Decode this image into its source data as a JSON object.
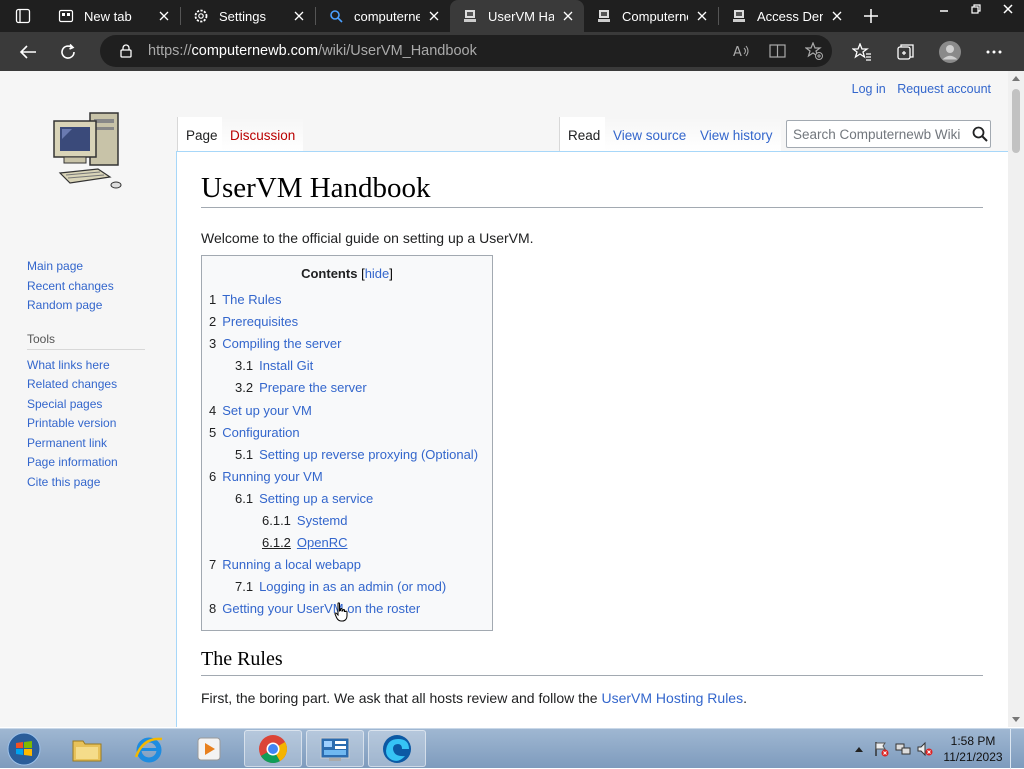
{
  "browser": {
    "tabs": [
      {
        "title": "New tab",
        "icon": "new-tab-icon"
      },
      {
        "title": "Settings",
        "icon": "gear-icon"
      },
      {
        "title": "computernew",
        "icon": "search-icon"
      },
      {
        "title": "UserVM Hand",
        "icon": "wiki-icon",
        "active": true
      },
      {
        "title": "Computernew",
        "icon": "wiki-icon"
      },
      {
        "title": "Access Denie",
        "icon": "wiki-icon"
      }
    ],
    "url_scheme": "https://",
    "url_host": "computernewb.com",
    "url_path": "/wiki/UserVM_Handbook"
  },
  "wiki": {
    "personal": {
      "login": "Log in",
      "request": "Request account"
    },
    "tabs": {
      "page": "Page",
      "discussion": "Discussion",
      "read": "Read",
      "view_source": "View source",
      "view_history": "View history"
    },
    "search_placeholder": "Search Computernewb Wiki",
    "sidebar": {
      "nav": [
        "Main page",
        "Recent changes",
        "Random page"
      ],
      "tools_heading": "Tools",
      "tools": [
        "What links here",
        "Related changes",
        "Special pages",
        "Printable version",
        "Permanent link",
        "Page information",
        "Cite this page"
      ]
    },
    "title": "UserVM Handbook",
    "intro": "Welcome to the official guide on setting up a UserVM.",
    "toc": {
      "title": "Contents",
      "hide_open": "[",
      "hide": "hide",
      "hide_close": "]",
      "items": [
        {
          "num": "1",
          "text": "The Rules",
          "level": 1
        },
        {
          "num": "2",
          "text": "Prerequisites",
          "level": 1
        },
        {
          "num": "3",
          "text": "Compiling the server",
          "level": 1
        },
        {
          "num": "3.1",
          "text": "Install Git",
          "level": 2
        },
        {
          "num": "3.2",
          "text": "Prepare the server",
          "level": 2
        },
        {
          "num": "4",
          "text": "Set up your VM",
          "level": 1
        },
        {
          "num": "5",
          "text": "Configuration",
          "level": 1
        },
        {
          "num": "5.1",
          "text": "Setting up reverse proxying (Optional)",
          "level": 2
        },
        {
          "num": "6",
          "text": "Running your VM",
          "level": 1
        },
        {
          "num": "6.1",
          "text": "Setting up a service",
          "level": 2
        },
        {
          "num": "6.1.1",
          "text": "Systemd",
          "level": 3
        },
        {
          "num": "6.1.2",
          "text": "OpenRC",
          "level": 3,
          "hover": true
        },
        {
          "num": "7",
          "text": "Running a local webapp",
          "level": 1
        },
        {
          "num": "7.1",
          "text": "Logging in as an admin (or mod)",
          "level": 2
        },
        {
          "num": "8",
          "text": "Getting your UserVM on the roster",
          "level": 1
        }
      ]
    },
    "section_rules": {
      "heading": "The Rules",
      "text": "First, the boring part. We ask that all hosts review and follow the ",
      "link": "UserVM Hosting Rules",
      "after": "."
    }
  },
  "taskbar": {
    "apps": [
      "explorer-icon",
      "ie-icon",
      "media-player-icon",
      "chrome-icon",
      "control-panel-icon",
      "edge-icon"
    ],
    "time": "1:58 PM",
    "date": "11/21/2023"
  },
  "colors": {
    "link": "#3366cc",
    "tabbar": "#1f1f1f",
    "toolbar": "#3a3a3a"
  }
}
